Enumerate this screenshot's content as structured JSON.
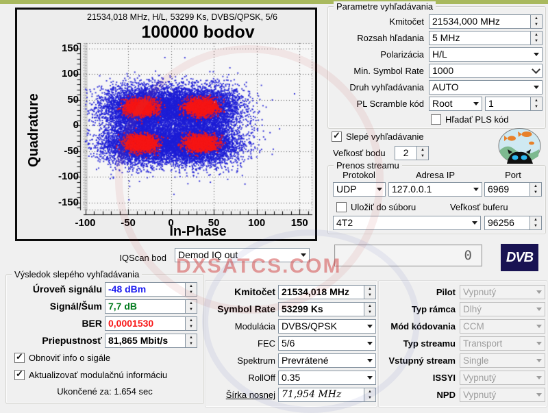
{
  "watermark": {
    "text": "DXSATCS.COM"
  },
  "chart_data": {
    "type": "scatter",
    "header": "21534,018 MHz, H/L, 53299 Ks, DVBS/QPSK, 5/6",
    "title": "100000 bodov",
    "xlabel": "In-Phase",
    "ylabel": "Quadrature",
    "xlim": [
      -102,
      165
    ],
    "ylim": [
      -165,
      160
    ],
    "x_ticks": [
      -100,
      -50,
      0,
      50,
      100,
      150
    ],
    "y_ticks": [
      150,
      100,
      50,
      0,
      -50,
      -100,
      -150
    ],
    "grid": "dotted",
    "total_points": 100000,
    "modulation": "QPSK",
    "clusters": [
      {
        "cx": -35,
        "cy": 35
      },
      {
        "cx": 35,
        "cy": 35
      },
      {
        "cx": -35,
        "cy": -35
      },
      {
        "cx": 35,
        "cy": -35
      }
    ],
    "cluster_cloud_sigma": [
      24,
      21
    ],
    "cluster_core_sigma": [
      9,
      8
    ],
    "colors": {
      "cloud": "#1d1dd6",
      "core": "#f51515"
    }
  },
  "iqscan": {
    "label": "IQScan bod",
    "value": "Demod IQ out"
  },
  "search_params": {
    "title": "Parametre vyhľadávania",
    "rows": [
      {
        "label": "Kmitočet",
        "value": "21534,000 MHz",
        "control": "spin"
      },
      {
        "label": "Rozsah hľadania",
        "value": "5 MHz",
        "control": "spin"
      },
      {
        "label": "Polarizácia",
        "value": "H/L",
        "control": "dropdown"
      },
      {
        "label": "Min. Symbol Rate",
        "value": "1000",
        "control": "combo"
      },
      {
        "label": "Druh vyhľadávania",
        "value": "AUTO",
        "control": "dropdown"
      }
    ],
    "pl_row": {
      "label": "PL Scramble kód",
      "dropdown_value": "Root",
      "spin_value": "1"
    },
    "pls_checkbox": {
      "label": "Hľadať PLS kód",
      "checked": false
    }
  },
  "blind": {
    "checkbox": {
      "label": "Slepé vyhľadávanie",
      "checked": true
    },
    "dot_size": {
      "label": "Veľkosť bodu",
      "value": "2"
    },
    "icon": "fish-aquarium"
  },
  "stream": {
    "title": "Prenos streamu",
    "col_headers": [
      "Protokol",
      "Adresa IP",
      "Port"
    ],
    "protocol": "UDP",
    "ip": "127.0.0.1",
    "port": "6969",
    "save_checkbox": {
      "label": "Uložiť do súboru",
      "checked": false
    },
    "buffer_label": "Veľkosť buferu",
    "device": "4T2",
    "buffer_value": "96256"
  },
  "progress": {
    "value": "0"
  },
  "dvb_logo": {
    "text": "DVB"
  },
  "results": {
    "title": "Výsledok slepého vyhľadávania",
    "rows": [
      {
        "label": "Úroveň signálu",
        "value": "-48 dBm",
        "color": "#1a1af0"
      },
      {
        "label": "Signál/Šum",
        "value": "7,7 dB",
        "color": "#007a1c"
      },
      {
        "label": "BER",
        "value": "0,0001530",
        "color": "#f81616"
      },
      {
        "label": "Priepustnosť",
        "value": "81,865 Mbit/s",
        "color": "#000000"
      }
    ],
    "checkboxes": [
      {
        "label": "Obnoviť info o sigále",
        "checked": true
      },
      {
        "label": "Aktualizovať modulačnú informáciu",
        "checked": true
      }
    ],
    "elapsed": "Ukončené za:  1.654 sec"
  },
  "tuner": {
    "rows": [
      {
        "label": "Kmitočet",
        "value": "21534,018 MHz",
        "control": "spin",
        "bold": true
      },
      {
        "label": "Symbol Rate",
        "value": "53299 Ks",
        "control": "spin",
        "bold": true
      },
      {
        "label": "Modulácia",
        "value": "DVBS/QPSK",
        "control": "dropdown"
      },
      {
        "label": "FEC",
        "value": "5/6",
        "control": "dropdown"
      },
      {
        "label": "Spektrum",
        "value": "Prevrátené",
        "control": "dropdown"
      },
      {
        "label": "RollOff",
        "value": "0.35",
        "control": "dropdown"
      },
      {
        "label": "Šírka nosnej",
        "value": "71,954 MHz",
        "control": "spin",
        "underline": true,
        "italic": true
      }
    ]
  },
  "status": {
    "rows": [
      {
        "label": "Pilot",
        "value": "Vypnutý"
      },
      {
        "label": "Typ rámca",
        "value": "Dlhý"
      },
      {
        "label": "Mód kódovania",
        "value": "CCM"
      },
      {
        "label": "Typ streamu",
        "value": "Transport"
      },
      {
        "label": "Vstupný stream",
        "value": "Single"
      },
      {
        "label": "ISSYI",
        "value": "Vypnutý"
      },
      {
        "label": "NPD",
        "value": "Vypnutý"
      }
    ]
  }
}
